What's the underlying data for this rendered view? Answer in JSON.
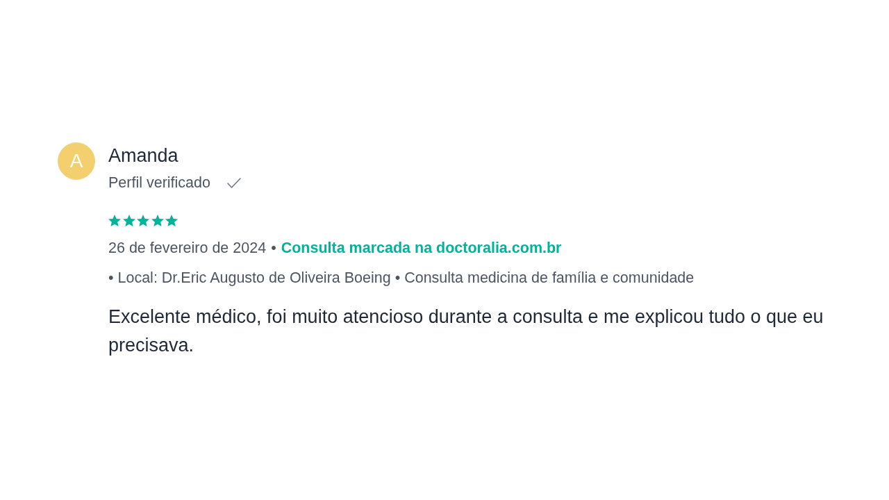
{
  "review": {
    "avatar": {
      "initial": "A"
    },
    "author": "Amanda",
    "verified_label": "Perfil verificado",
    "stars": 5,
    "date": "26 de fevereiro de 2024",
    "separator": "•",
    "source": "Consulta marcada na doctoralia.com.br",
    "details": "• Local: Dr.Eric Augusto de Oliveira Boeing • Consulta medicina de família e comunidade",
    "text": "Excelente médico, foi muito atencioso durante a consulta e me explicou tudo o que eu precisava."
  }
}
